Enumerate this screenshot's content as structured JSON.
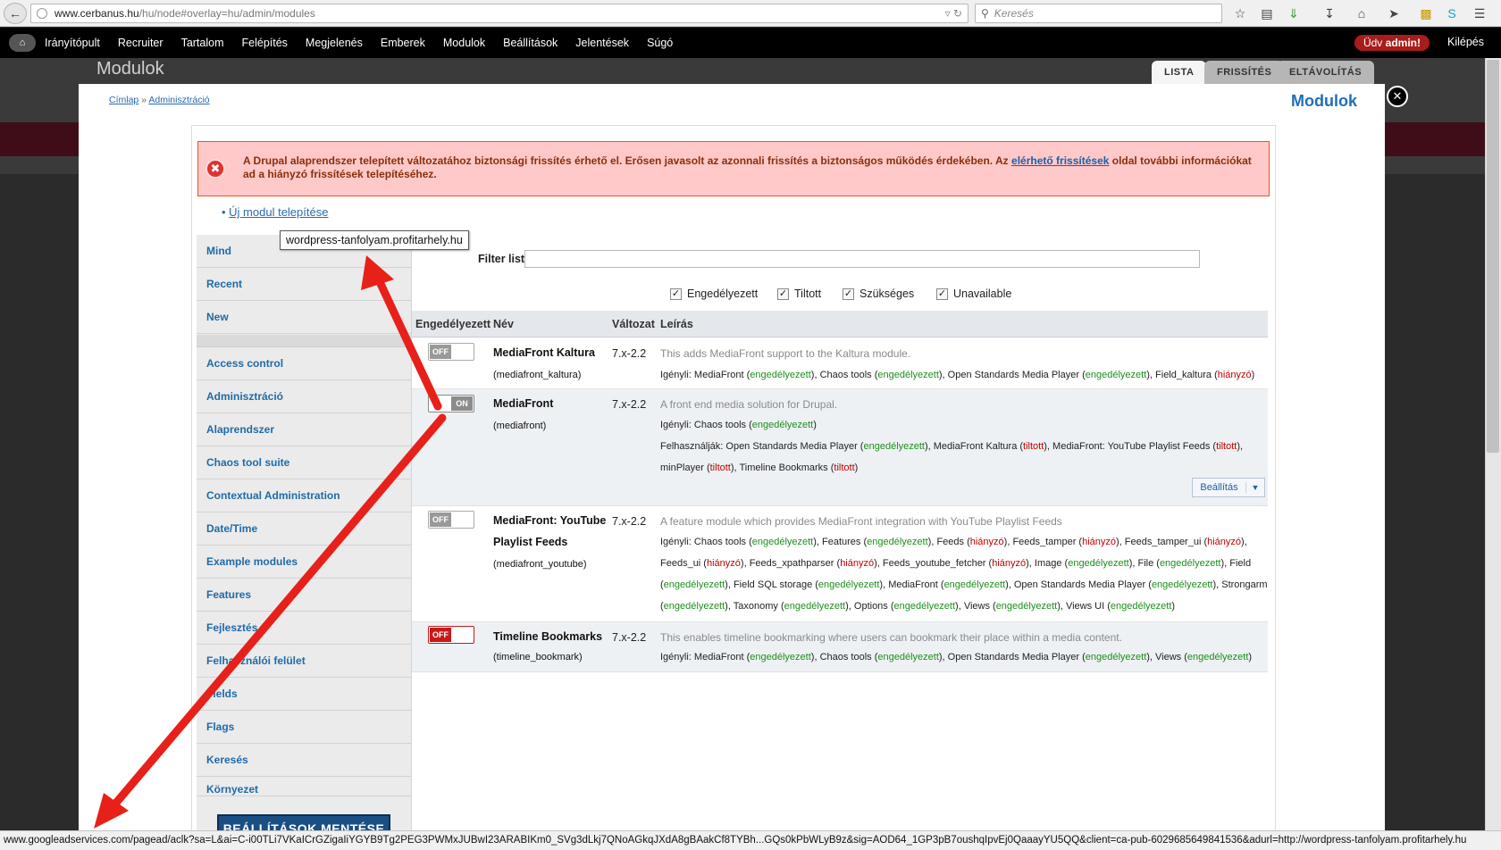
{
  "browser": {
    "url_host": "www.cerbanus.hu",
    "url_path": "/hu/node#overlay=hu/admin/modules",
    "search_placeholder": "Keresés"
  },
  "admin_bar": {
    "items": [
      "Irányítópult",
      "Recruiter",
      "Tartalom",
      "Felépítés",
      "Megjelenés",
      "Emberek",
      "Modulok",
      "Beállítások",
      "Jelentések",
      "Súgó"
    ],
    "welcome_prefix": "Üdv",
    "welcome_user": "admin!",
    "logout": "Kilépés"
  },
  "page": {
    "dim_title": "Modulok",
    "tabs": [
      "LISTA",
      "FRISSÍTÉS",
      "ELTÁVOLÍTÁS"
    ],
    "breadcrumb": [
      "Címlap",
      "Adminisztráció"
    ],
    "breadcrumb_sep": "»",
    "overlay_title": "Modulok"
  },
  "error": {
    "text_before": "A Drupal alaprendszer telepített változatához biztonsági frissítés érhető el. Erősen javasolt az azonnali frissítés a biztonságos működés érdekében. Az",
    "link": "elérhető frissítések",
    "text_after": "oldal további információkat ad a hiányzó frissítések telepítéséhez."
  },
  "install_link": "Új modul telepítése",
  "tooltip": "wordpress-tanfolyam.profitarhely.hu",
  "sidebar": {
    "items": [
      "Mind",
      "Recent",
      "New",
      "Access control",
      "Adminisztráció",
      "Alaprendszer",
      "Chaos tool suite",
      "Contextual Administration",
      "Date/Time",
      "Example modules",
      "Features",
      "Fejlesztés",
      "Felhasználói felület",
      "Fields",
      "Flags",
      "Keresés",
      "Környezet"
    ],
    "save_button": "BEÁLLÍTÁSOK MENTÉSE"
  },
  "filter": {
    "label": "Filter list",
    "checkboxes": [
      "Engedélyezett",
      "Tiltott",
      "Szükséges",
      "Unavailable"
    ]
  },
  "table": {
    "headers": [
      "Engedélyezett",
      "Név",
      "Változat",
      "Leírás"
    ],
    "toggle_off": "OFF",
    "toggle_on": "ON",
    "settings_button": "Beállítás",
    "rows": [
      {
        "name": "MediaFront Kaltura",
        "machine": "(mediafront_kaltura)",
        "version": "7.x-2.2",
        "description": "This adds MediaFront support to the Kaltura module.",
        "requires_label": "Igényli:",
        "requires": [
          [
            "MediaFront",
            "engedélyezett"
          ],
          [
            "Chaos tools",
            "engedélyezett"
          ],
          [
            "Open Standards Media Player",
            "engedélyezett"
          ],
          [
            "Field_kaltura",
            "hiányzó"
          ]
        ]
      },
      {
        "name": "MediaFront",
        "machine": "(mediafront)",
        "version": "7.x-2.2",
        "description": "A front end media solution for Drupal.",
        "requires_label": "Igényli:",
        "requires": [
          [
            "Chaos tools",
            "engedélyezett"
          ]
        ],
        "users_label": "Felhasználják:",
        "users_line1": [
          [
            "Open Standards Media Player",
            "engedélyezett"
          ],
          [
            "MediaFront Kaltura",
            "tiltott"
          ],
          [
            "MediaFront: YouTube Playlist Feeds",
            "tiltott"
          ]
        ],
        "users_line2": [
          [
            "minPlayer",
            "tiltott"
          ],
          [
            "Timeline Bookmarks",
            "tiltott"
          ]
        ]
      },
      {
        "name_line1": "MediaFront: YouTube",
        "name_line2": "Playlist Feeds",
        "machine": "(mediafront_youtube)",
        "version": "7.x-2.2",
        "description": "A feature module which provides MediaFront integration with YouTube Playlist Feeds",
        "requires_label": "Igényli:",
        "line1": [
          [
            "Chaos tools",
            "engedélyezett"
          ],
          [
            "Features",
            "engedélyezett"
          ],
          [
            "Feeds",
            "hiányzó"
          ],
          [
            "Feeds_tamper",
            "hiányzó"
          ],
          [
            "Feeds_tamper_ui",
            "hiányzó"
          ]
        ],
        "line2": [
          [
            "Feeds_ui",
            "hiányzó"
          ],
          [
            "Feeds_xpathparser",
            "hiányzó"
          ],
          [
            "Feeds_youtube_fetcher",
            "hiányzó"
          ],
          [
            "Image",
            "engedélyezett"
          ],
          [
            "File",
            "engedélyezett"
          ]
        ],
        "line2_tail": "Field",
        "line3_head": "engedélyezett",
        "line3": [
          [
            "Field SQL storage",
            "engedélyezett"
          ],
          [
            "MediaFront",
            "engedélyezett"
          ],
          [
            "Open Standards Media Player",
            "engedélyezett"
          ]
        ],
        "line3_tail": "Strongarm",
        "line4_head": "engedélyezett",
        "line4": [
          [
            "Taxonomy",
            "engedélyezett"
          ],
          [
            "Options",
            "engedélyezett"
          ],
          [
            "Views",
            "engedélyezett"
          ],
          [
            "Views UI",
            "engedélyezett"
          ]
        ]
      },
      {
        "name": "Timeline Bookmarks",
        "machine": "(timeline_bookmark)",
        "version": "7.x-2.2",
        "description": "This enables timeline bookmarking where users can bookmark their place within a media content.",
        "requires_label": "Igényli:",
        "requires": [
          [
            "MediaFront",
            "engedélyezett"
          ],
          [
            "Chaos tools",
            "engedélyezett"
          ],
          [
            "Open Standards Media Player",
            "engedélyezett"
          ],
          [
            "Views",
            "engedélyezett"
          ]
        ]
      }
    ]
  },
  "status_bar": "www.googleadservices.com/pagead/aclk?sa=L&ai=C-i00TLi7VKaICrGZigaIiYGYB9Tg2PEG3PWMxJUBwI23ARABIKm0_SVg3dLkj7QNoAGkqJXdA8gBAakCf8TYBh...GQs0kPbWLyB9z&sig=AOD64_1GP3pB7oushqIpvEj0QaaayYU5QQ&client=ca-pub-6029685649841536&adurl=http://wordpress-tanfolyam.profitarhely.hu",
  "colors": {
    "accent": "#1f6fb5",
    "error_bg": "#ffc9c9",
    "ok": "#1d8f1d",
    "missing": "#c10000",
    "arrow": "#e8201a"
  }
}
